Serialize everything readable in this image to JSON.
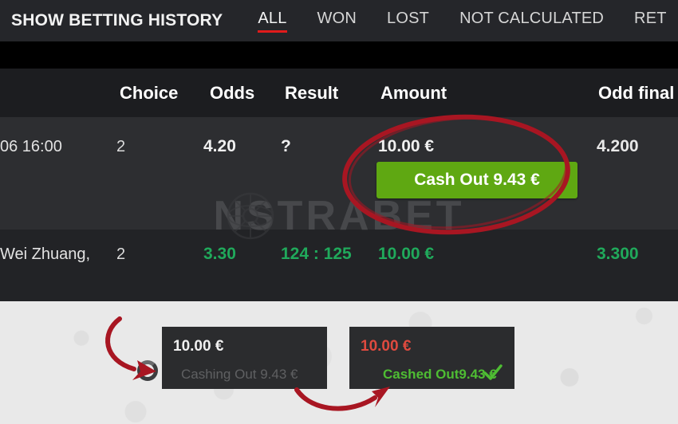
{
  "header": {
    "title": "SHOW BETTING HISTORY",
    "tabs": [
      {
        "label": "ALL",
        "active": true
      },
      {
        "label": "WON",
        "active": false
      },
      {
        "label": "LOST",
        "active": false
      },
      {
        "label": "NOT CALCULATED",
        "active": false
      },
      {
        "label": "RET",
        "active": false
      }
    ]
  },
  "table": {
    "columns": {
      "choice": "Choice",
      "odds": "Odds",
      "result": "Result",
      "amount": "Amount",
      "odd_final": "Odd final"
    },
    "rows": [
      {
        "event": "06 16:00",
        "choice": "2",
        "odds": "4.20",
        "result": "?",
        "amount": "10.00 €",
        "odd_final": "4.200",
        "cashout_label": "Cash Out 9.43 €",
        "status": "pending"
      },
      {
        "event": "Wei Zhuang,",
        "choice": "2",
        "odds": "3.30",
        "result": "124 : 125",
        "amount": "10.00 €",
        "odd_final": "3.300",
        "status": "won"
      }
    ]
  },
  "watermark": {
    "text_left": "N",
    "text_right": "STRABET",
    "icon": "football-globe-icon"
  },
  "popups": {
    "pending": {
      "amount": "10.00 €",
      "status": "Cashing Out 9.43 €",
      "spinner": "loading-spinner-icon"
    },
    "confirmed": {
      "amount": "10.00 €",
      "status": "Cashed Out9.43 €",
      "check": "check-icon"
    }
  },
  "annotations": {
    "ellipse": "red-ellipse-highlight",
    "arrow_one": "red-curved-arrow-to-pending-popup",
    "arrow_two": "red-curved-arrow-to-confirmed-popup"
  },
  "colors": {
    "accent_red": "#d01818",
    "annotation_red": "#a81622",
    "cashout_green": "#5fa812",
    "win_green": "#20a95b",
    "popup_red": "#df4a3f",
    "popup_green": "#4ebd33",
    "dark_bg": "#25262a",
    "row_alt": "#2d2e31",
    "light_bg": "#e9e9e9"
  }
}
